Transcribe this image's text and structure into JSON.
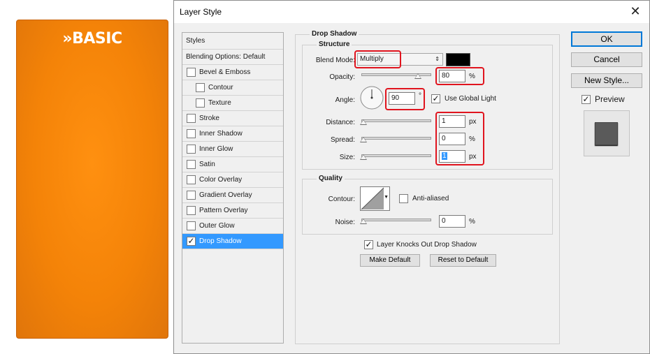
{
  "card": {
    "title": "»BASIC",
    "color": "#f48308"
  },
  "dialog": {
    "title": "Layer Style",
    "close_icon": "close-icon"
  },
  "styles_panel": {
    "header": "Styles",
    "blending": "Blending Options: Default",
    "items": [
      {
        "label": "Bevel & Emboss",
        "checked": false
      },
      {
        "label": "Contour",
        "checked": false
      },
      {
        "label": "Texture",
        "checked": false
      },
      {
        "label": "Stroke",
        "checked": false
      },
      {
        "label": "Inner Shadow",
        "checked": false
      },
      {
        "label": "Inner Glow",
        "checked": false
      },
      {
        "label": "Satin",
        "checked": false
      },
      {
        "label": "Color Overlay",
        "checked": false
      },
      {
        "label": "Gradient Overlay",
        "checked": false
      },
      {
        "label": "Pattern Overlay",
        "checked": false
      },
      {
        "label": "Outer Glow",
        "checked": false
      },
      {
        "label": "Drop Shadow",
        "checked": true,
        "selected": true
      }
    ]
  },
  "drop_shadow": {
    "title": "Drop Shadow",
    "structure": {
      "title": "Structure",
      "blend_mode_label": "Blend Mode:",
      "blend_mode_value": "Multiply",
      "shadow_color": "#000000",
      "opacity_label": "Opacity:",
      "opacity_value": "80",
      "opacity_unit": "%",
      "angle_label": "Angle:",
      "angle_value": "90",
      "angle_unit": "°",
      "use_global_light_label": "Use Global Light",
      "use_global_light_checked": true,
      "distance_label": "Distance:",
      "distance_value": "1",
      "distance_unit": "px",
      "spread_label": "Spread:",
      "spread_value": "0",
      "spread_unit": "%",
      "size_label": "Size:",
      "size_value": "1",
      "size_unit": "px"
    },
    "quality": {
      "title": "Quality",
      "contour_label": "Contour:",
      "anti_aliased_label": "Anti-aliased",
      "anti_aliased_checked": false,
      "noise_label": "Noise:",
      "noise_value": "0",
      "noise_unit": "%"
    },
    "layer_knocks_out_label": "Layer Knocks Out Drop Shadow",
    "layer_knocks_out_checked": true,
    "make_default_label": "Make Default",
    "reset_default_label": "Reset to Default"
  },
  "buttons": {
    "ok": "OK",
    "cancel": "Cancel",
    "new_style": "New Style...",
    "preview_label": "Preview",
    "preview_checked": true
  },
  "highlight_color": "#e0141e"
}
